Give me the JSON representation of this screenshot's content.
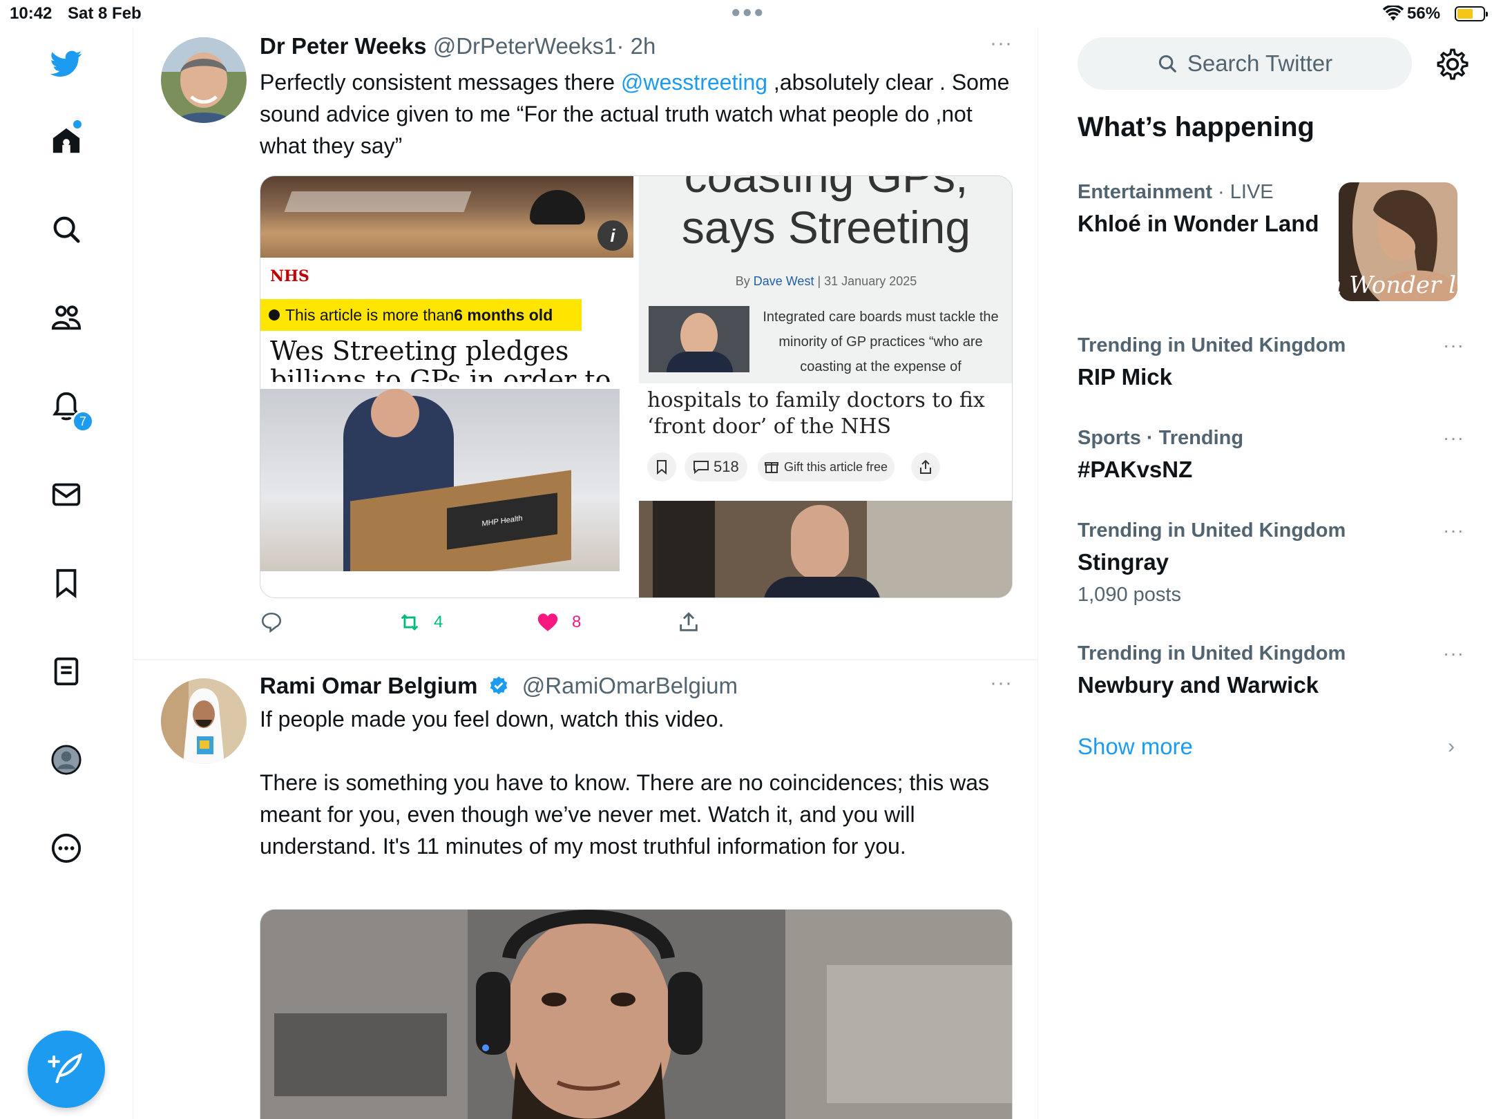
{
  "status_bar": {
    "time": "10:42",
    "date": "Sat 8 Feb",
    "battery": "56%"
  },
  "sidebar": {
    "notifications_badge": "7",
    "icons": [
      "twitter-bird-icon",
      "home-icon",
      "search-icon",
      "communities-icon",
      "notifications-icon",
      "messages-icon",
      "bookmarks-icon",
      "lists-icon",
      "profile-icon",
      "more-icon"
    ]
  },
  "tweets": [
    {
      "name": "Dr Peter Weeks",
      "handle": "@DrPeterWeeks1",
      "time": "· 2h",
      "more": "···",
      "text_before": "Perfectly consistent messages there ",
      "mention": "@wesstreeting",
      "text_after": " ,absolutely clear . Some sound advice given to me “For the actual truth watch what people do ,not what they say”",
      "media": {
        "nhs_label": "NHS",
        "old_article_prefix": "This article is more than ",
        "old_article_bold": "6 months old",
        "left_headline": "Wes Streeting pledges",
        "left_headline_cut": "billions to GPs in order to",
        "podium_sign": "MHP Health",
        "right_headline_cut": "coasting GPs,",
        "right_headline": "says Streeting",
        "byline_prefix": "By ",
        "byline_author": "Dave West",
        "byline_date": "31 January 2025",
        "right_snippet": "Integrated care boards must tackle the minority of GP practices “who are coasting at the expense of",
        "lower_headline": "hospitals to family doctors to fix ‘front door’ of the NHS",
        "comment_count": "518",
        "gift_label": "Gift this article free",
        "info_icon": "i"
      },
      "actions": {
        "retweets": "4",
        "likes": "8"
      }
    },
    {
      "name": "Rami Omar Belgium",
      "handle": "@RamiOmarBelgium",
      "more": "···",
      "text_line1": "If people made you feel down, watch this video.",
      "text_para2": "There is something you have to know. There are no coincidences; this was meant for you, even though we’ve never met. Watch it, and you will understand. It's 11 minutes of my most truthful information for you."
    }
  ],
  "right_column": {
    "search_placeholder": "Search Twitter",
    "section_title": "What’s happening",
    "trends": [
      {
        "category": "Entertainment",
        "live": " · LIVE",
        "title": "Khloé in Wonder Land",
        "image_text": "é in Wonder l"
      },
      {
        "category": "Trending in United Kingdom",
        "title": "RIP Mick",
        "more": "···"
      },
      {
        "category": "Sports · Trending",
        "title": "#PAKvsNZ",
        "more": "···"
      },
      {
        "category": "Trending in United Kingdom",
        "title": "Stingray",
        "posts": "1,090 posts",
        "more": "···"
      },
      {
        "category": "Trending in United Kingdom",
        "title": "Newbury and Warwick",
        "more": "···"
      }
    ],
    "show_more": "Show more",
    "chevron": "›"
  },
  "colors": {
    "accent": "#1d9bf0",
    "like": "#f91880",
    "retweet": "#00ba7c",
    "secondary_text": "#536471",
    "nhs_red": "#c00000",
    "highlight_yellow": "#ffe500"
  }
}
